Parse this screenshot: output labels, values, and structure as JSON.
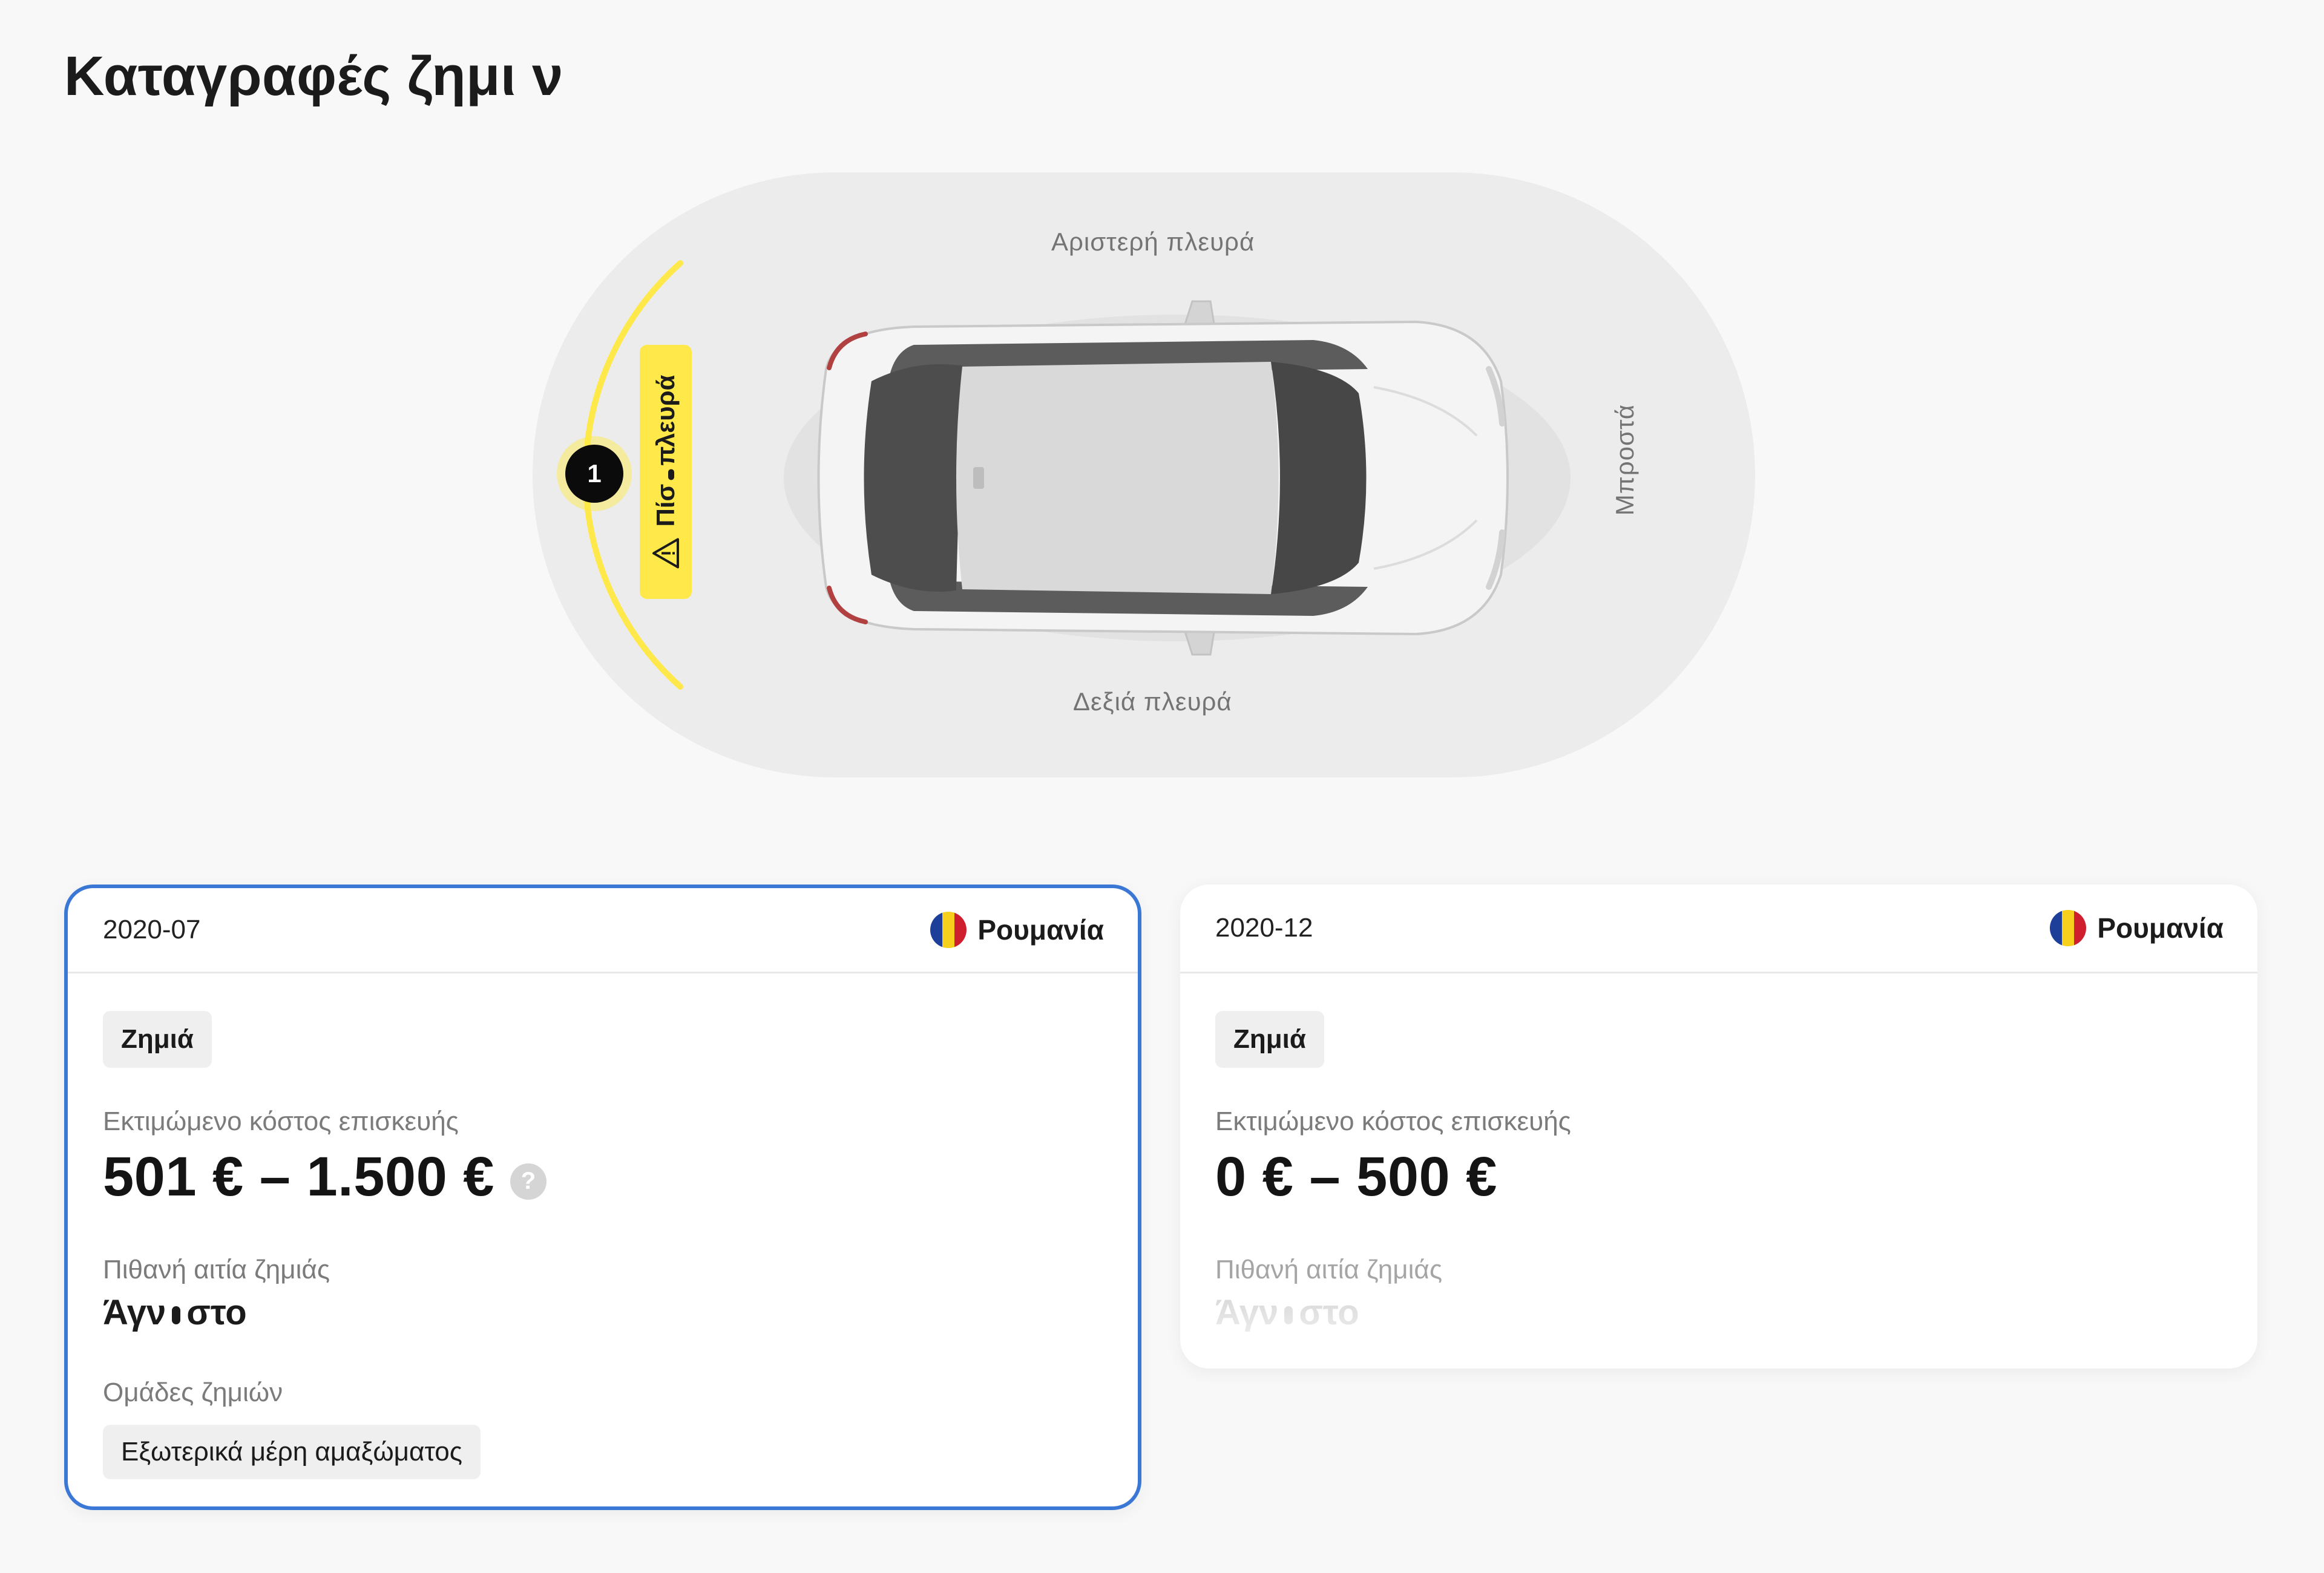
{
  "page": {
    "title": "Καταγραφές ζημι ν"
  },
  "diagram": {
    "left_side_label": "Αριστερή πλευρά",
    "right_side_label": "Δεξιά πλευρά",
    "front_label": "Μπροστά",
    "marker_number": "1",
    "zone_chip_label_a": "Πίσ",
    "zone_chip_label_b": "πλευρά",
    "highlight_color": "#ffe84a"
  },
  "cards": [
    {
      "date": "2020-07",
      "country": "Ρουμανία",
      "tag": "Ζημιά",
      "cost_label": "Εκτιμώμενο κόστος επισκευής",
      "cost_value": "501 € – 1.500 €",
      "help_icon": "?",
      "cause_label": "Πιθανή αιτία ζημιάς",
      "cause_value_a": "Άγν",
      "cause_value_b": "στο",
      "groups_label": "Ομάδες ζημιών",
      "group_tag": "Εξωτερικά μέρη αμαξώματος",
      "selected": true
    },
    {
      "date": "2020-12",
      "country": "Ρουμανία",
      "tag": "Ζημιά",
      "cost_label": "Εκτιμώμενο κόστος επισκευής",
      "cost_value": "0 € – 500 €",
      "cause_label": "Πιθανή αιτία ζημιάς",
      "cause_value_a": "Άγν",
      "cause_value_b": "στο",
      "selected": false
    }
  ],
  "colors": {
    "selected_border": "#3b78d6",
    "flag_blue": "#1d3f9a",
    "flag_yellow": "#f7cf1d",
    "flag_red": "#cf1f2e"
  }
}
